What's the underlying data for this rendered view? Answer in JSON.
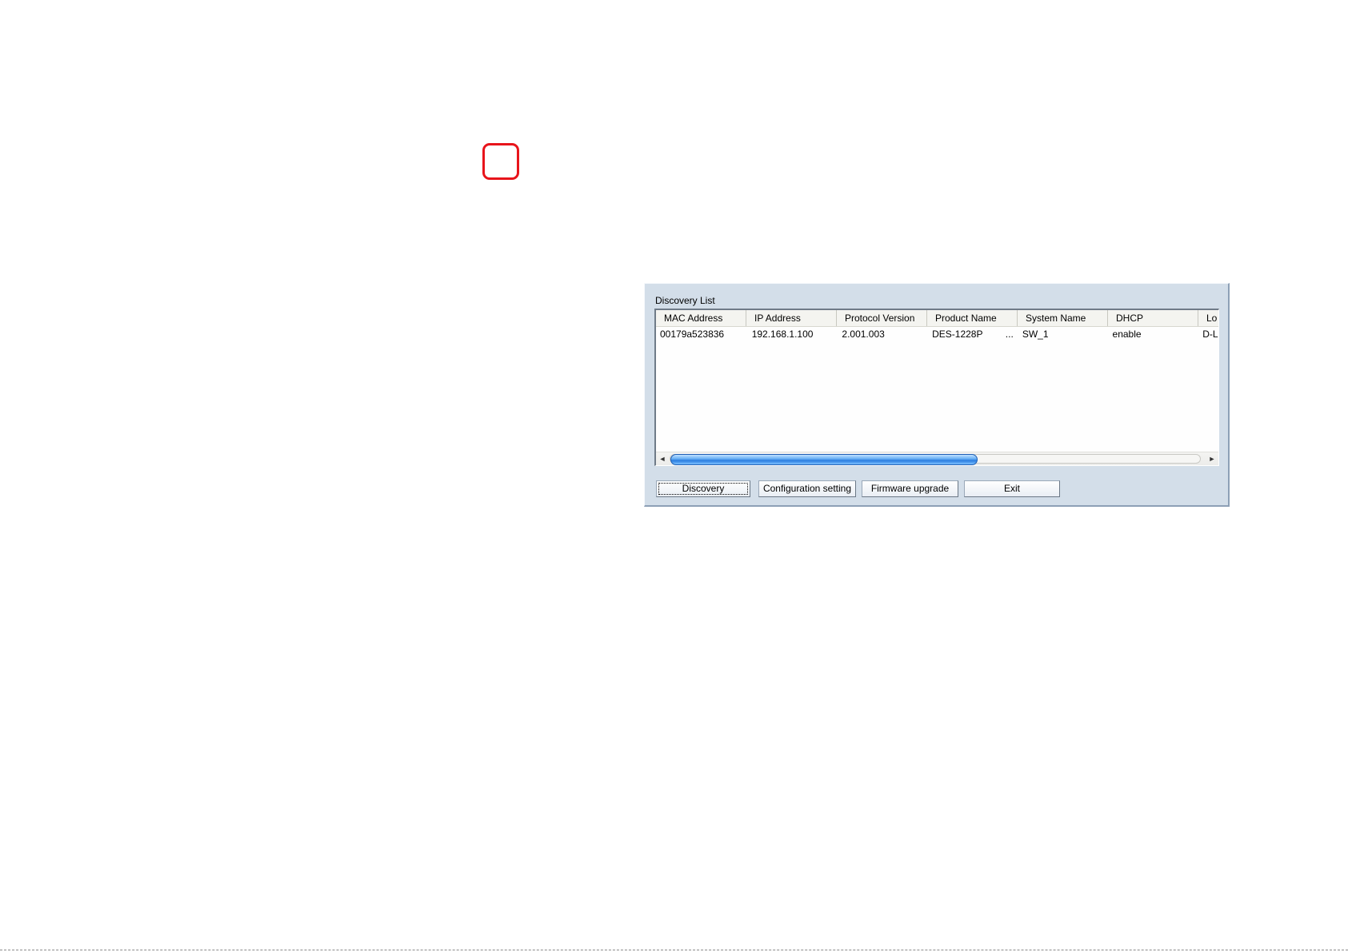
{
  "panel": {
    "title": "Discovery List"
  },
  "list": {
    "columns": [
      "MAC Address",
      "IP Address",
      "Protocol Version",
      "Product Name",
      "System Name",
      "DHCP",
      "Lo"
    ],
    "rows": [
      {
        "mac": "00179a523836",
        "ip": "192.168.1.100",
        "protocol": "2.001.003",
        "product": "DES-1228P",
        "product_more": "...",
        "system": "SW_1",
        "dhcp": "enable",
        "location": "D-L"
      }
    ],
    "horizontal_scroll_fraction": 0.58,
    "scroll_left_icon": "◄",
    "scroll_right_icon": "►"
  },
  "buttons": {
    "discovery": "Discovery",
    "configuration": "Configuration setting",
    "firmware": "Firmware upgrade",
    "exit": "Exit"
  },
  "colors": {
    "marker": "#e8141b",
    "panel_bg": "#d3dee9",
    "scroll_thumb": "#2a7de0"
  }
}
